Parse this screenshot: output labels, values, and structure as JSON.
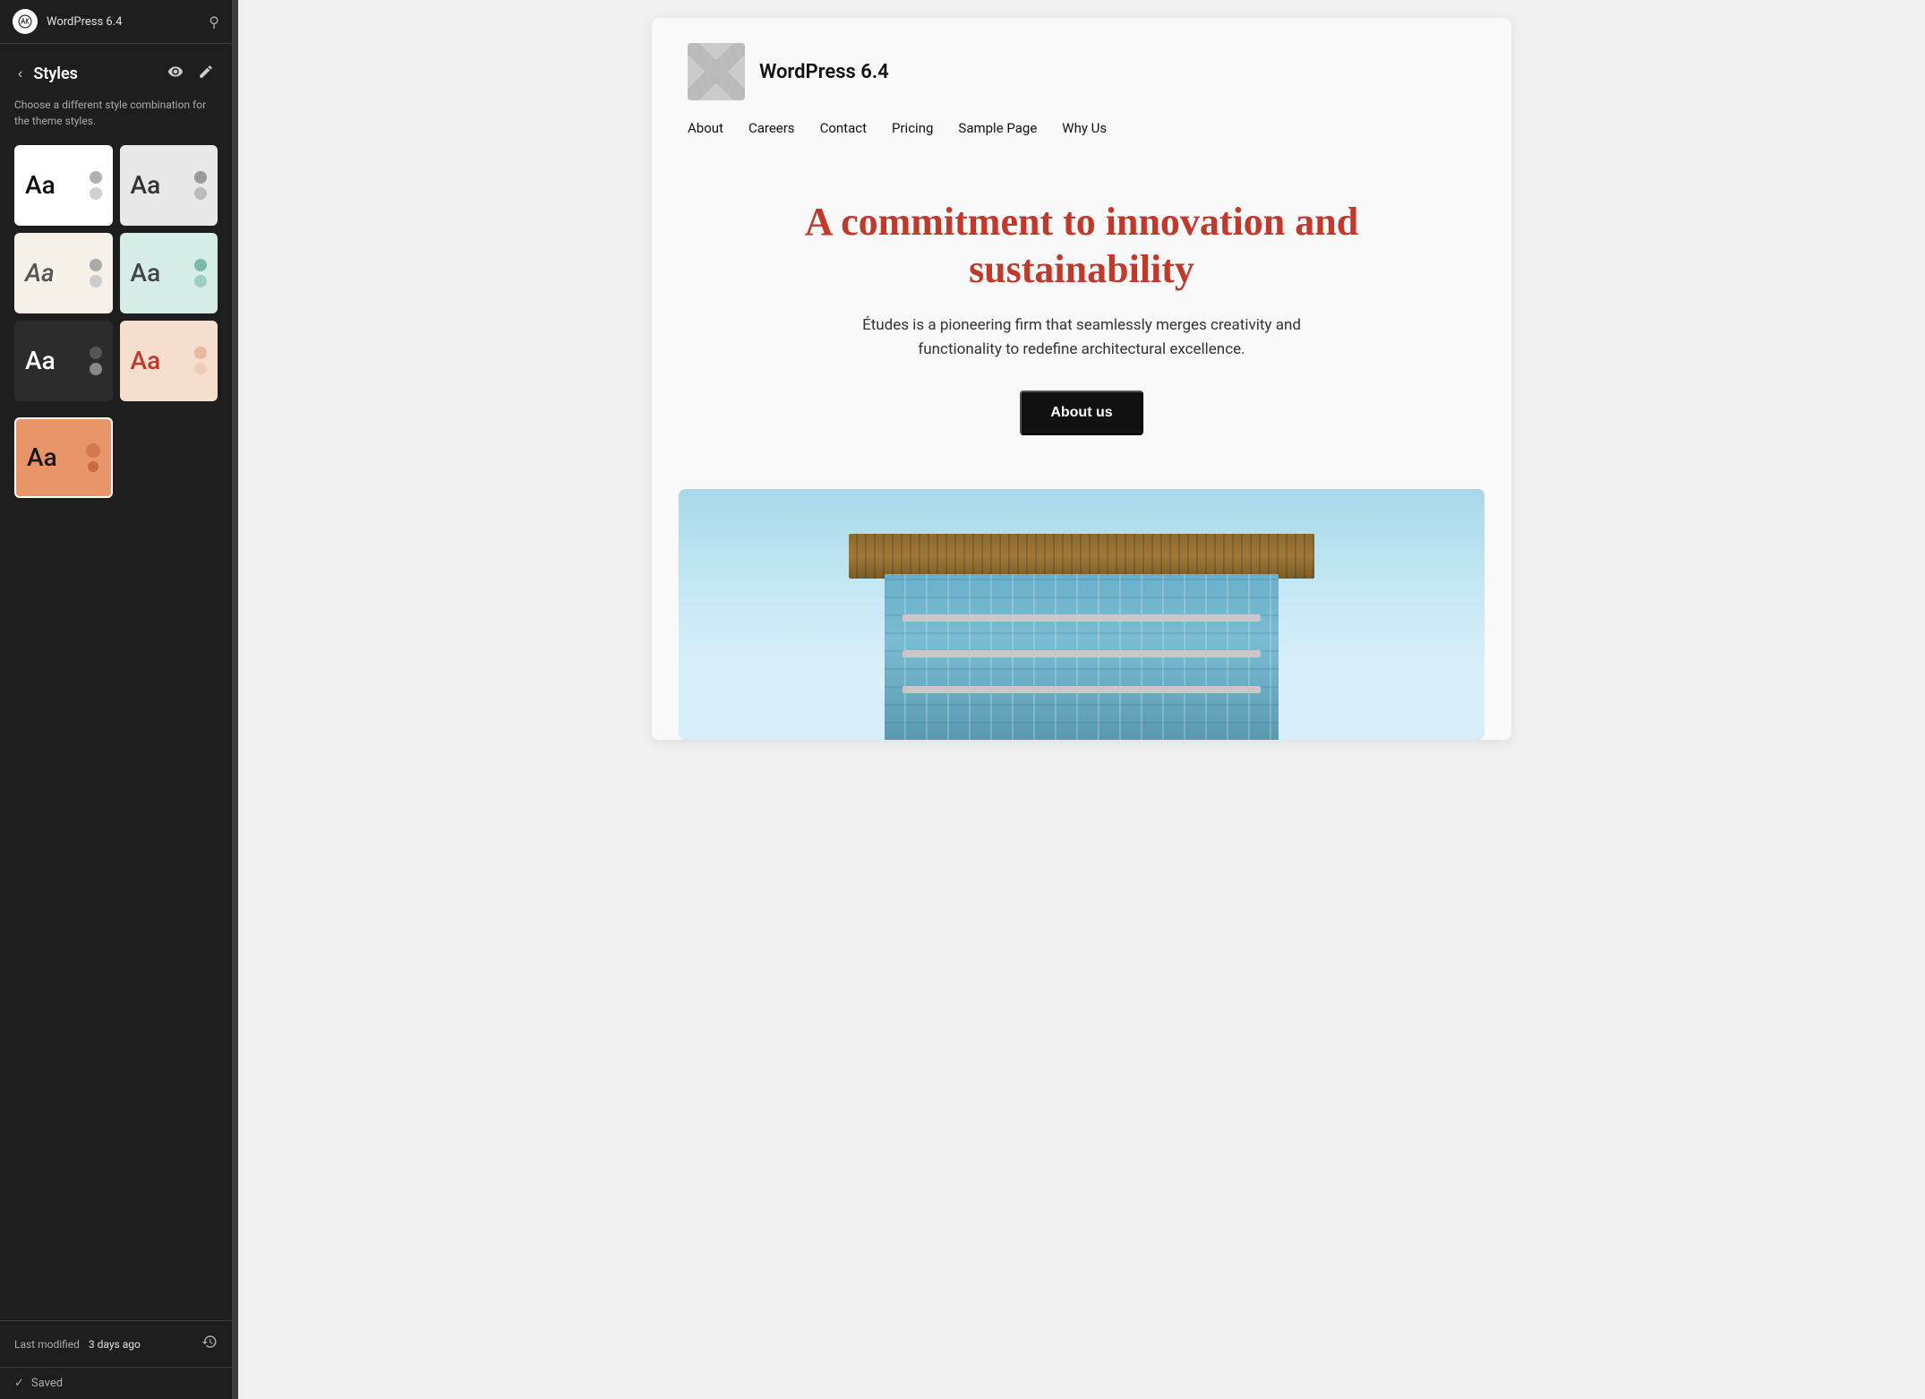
{
  "app": {
    "title": "WordPress 6.4",
    "search_label": "search"
  },
  "sidebar": {
    "back_label": "‹",
    "styles_title": "Styles",
    "description": "Choose a different style combination for the theme styles.",
    "preview_icon_label": "preview",
    "edit_icon_label": "edit",
    "style_cards": [
      {
        "id": "white",
        "theme": "card-white",
        "label": "Aa",
        "selected": false
      },
      {
        "id": "light-gray",
        "theme": "card-light-gray",
        "label": "Aa",
        "selected": false
      },
      {
        "id": "cream",
        "theme": "card-cream",
        "label": "Aa",
        "selected": false
      },
      {
        "id": "mint",
        "theme": "card-mint",
        "label": "Aa",
        "selected": false
      },
      {
        "id": "dark",
        "theme": "card-dark",
        "label": "Aa",
        "selected": false
      },
      {
        "id": "peach",
        "theme": "card-peach",
        "label": "Aa",
        "selected": false
      },
      {
        "id": "orange",
        "theme": "card-orange",
        "label": "Aa",
        "selected": true
      }
    ],
    "footer": {
      "last_modified_label": "Last modified",
      "last_modified_value": "3 days ago",
      "history_icon_label": "history"
    },
    "saved_label": "Saved",
    "check_icon_label": "checkmark"
  },
  "preview": {
    "site_title": "WordPress 6.4",
    "logo_alt": "site logo placeholder",
    "nav_items": [
      {
        "label": "About",
        "href": "#"
      },
      {
        "label": "Careers",
        "href": "#"
      },
      {
        "label": "Contact",
        "href": "#"
      },
      {
        "label": "Pricing",
        "href": "#"
      },
      {
        "label": "Sample Page",
        "href": "#"
      },
      {
        "label": "Why Us",
        "href": "#"
      }
    ],
    "hero": {
      "title": "A commitment to innovation and sustainability",
      "subtitle": "Études is a pioneering firm that seamlessly merges creativity and functionality to redefine architectural excellence.",
      "cta_label": "About us"
    },
    "image_alt": "architectural building photograph"
  }
}
